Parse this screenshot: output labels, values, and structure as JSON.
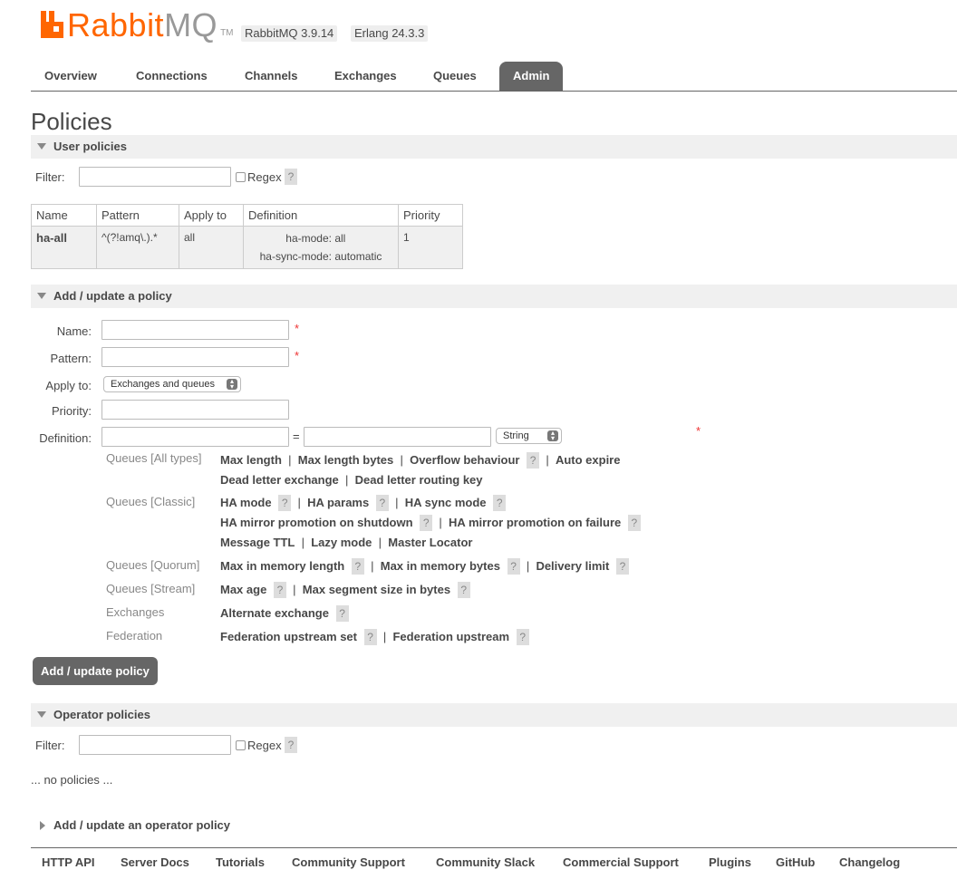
{
  "header": {
    "logo_rabbit": "Rabbit",
    "logo_mq": "MQ",
    "logo_tm": "TM",
    "rabbitmq_version": "RabbitMQ 3.9.14",
    "erlang_version": "Erlang 24.3.3"
  },
  "nav": {
    "tabs": [
      "Overview",
      "Connections",
      "Channels",
      "Exchanges",
      "Queues",
      "Admin"
    ],
    "active": "Admin"
  },
  "page_title": "Policies",
  "user_policies": {
    "title": "User policies",
    "filter_label": "Filter:",
    "regex_label": "Regex",
    "help": "?",
    "table": {
      "headers": [
        "Name",
        "Pattern",
        "Apply to",
        "Definition",
        "Priority"
      ],
      "rows": [
        {
          "name": "ha-all",
          "pattern": "^(?!amq\\.).*",
          "apply_to": "all",
          "definition": [
            {
              "key": "ha-mode:",
              "value": "all"
            },
            {
              "key": "ha-sync-mode:",
              "value": "automatic"
            }
          ],
          "priority": "1"
        }
      ]
    }
  },
  "add_policy": {
    "title": "Add / update a policy",
    "name_label": "Name:",
    "pattern_label": "Pattern:",
    "apply_to_label": "Apply to:",
    "apply_to_value": "Exchanges and queues",
    "priority_label": "Priority:",
    "definition_label": "Definition:",
    "equals": "=",
    "type_value": "String",
    "required": "*",
    "groups": [
      {
        "label": "Queues [All types]",
        "lines": [
          [
            {
              "k": "Max length"
            },
            {
              "k": "Max length bytes"
            },
            {
              "k": "Overflow behaviour",
              "help": true
            },
            {
              "k": "Auto expire"
            }
          ],
          [
            {
              "k": "Dead letter exchange"
            },
            {
              "k": "Dead letter routing key"
            }
          ]
        ]
      },
      {
        "label": "Queues [Classic]",
        "lines": [
          [
            {
              "k": "HA mode",
              "help": true
            },
            {
              "k": "HA params",
              "help": true
            },
            {
              "k": "HA sync mode",
              "help": true
            }
          ],
          [
            {
              "k": "HA mirror promotion on shutdown",
              "help": true
            },
            {
              "k": "HA mirror promotion on failure",
              "help": true
            }
          ],
          [
            {
              "k": "Message TTL"
            },
            {
              "k": "Lazy mode"
            },
            {
              "k": "Master Locator"
            }
          ]
        ]
      },
      {
        "label": "Queues [Quorum]",
        "lines": [
          [
            {
              "k": "Max in memory length",
              "help": true
            },
            {
              "k": "Max in memory bytes",
              "help": true
            },
            {
              "k": "Delivery limit",
              "help": true
            }
          ]
        ]
      },
      {
        "label": "Queues [Stream]",
        "lines": [
          [
            {
              "k": "Max age",
              "help": true
            },
            {
              "k": "Max segment size in bytes",
              "help": true
            }
          ]
        ]
      },
      {
        "label": "Exchanges",
        "lines": [
          [
            {
              "k": "Alternate exchange",
              "help": true
            }
          ]
        ]
      },
      {
        "label": "Federation",
        "lines": [
          [
            {
              "k": "Federation upstream set",
              "help": true
            },
            {
              "k": "Federation upstream",
              "help": true
            }
          ]
        ]
      }
    ],
    "submit_label": "Add / update policy"
  },
  "operator_policies": {
    "title": "Operator policies",
    "filter_label": "Filter:",
    "regex_label": "Regex",
    "help": "?",
    "empty_text": "... no policies ..."
  },
  "add_operator_policy": {
    "title": "Add / update an operator policy"
  },
  "footer": {
    "links": [
      "HTTP API",
      "Server Docs",
      "Tutorials",
      "Community Support",
      "Community Slack",
      "Commercial Support",
      "Plugins",
      "GitHub",
      "Changelog"
    ]
  },
  "colors": {
    "brand_orange": "#ff6600",
    "tab_active": "#666666",
    "section_bg": "#f0f0f0",
    "required": "#ee3333"
  }
}
